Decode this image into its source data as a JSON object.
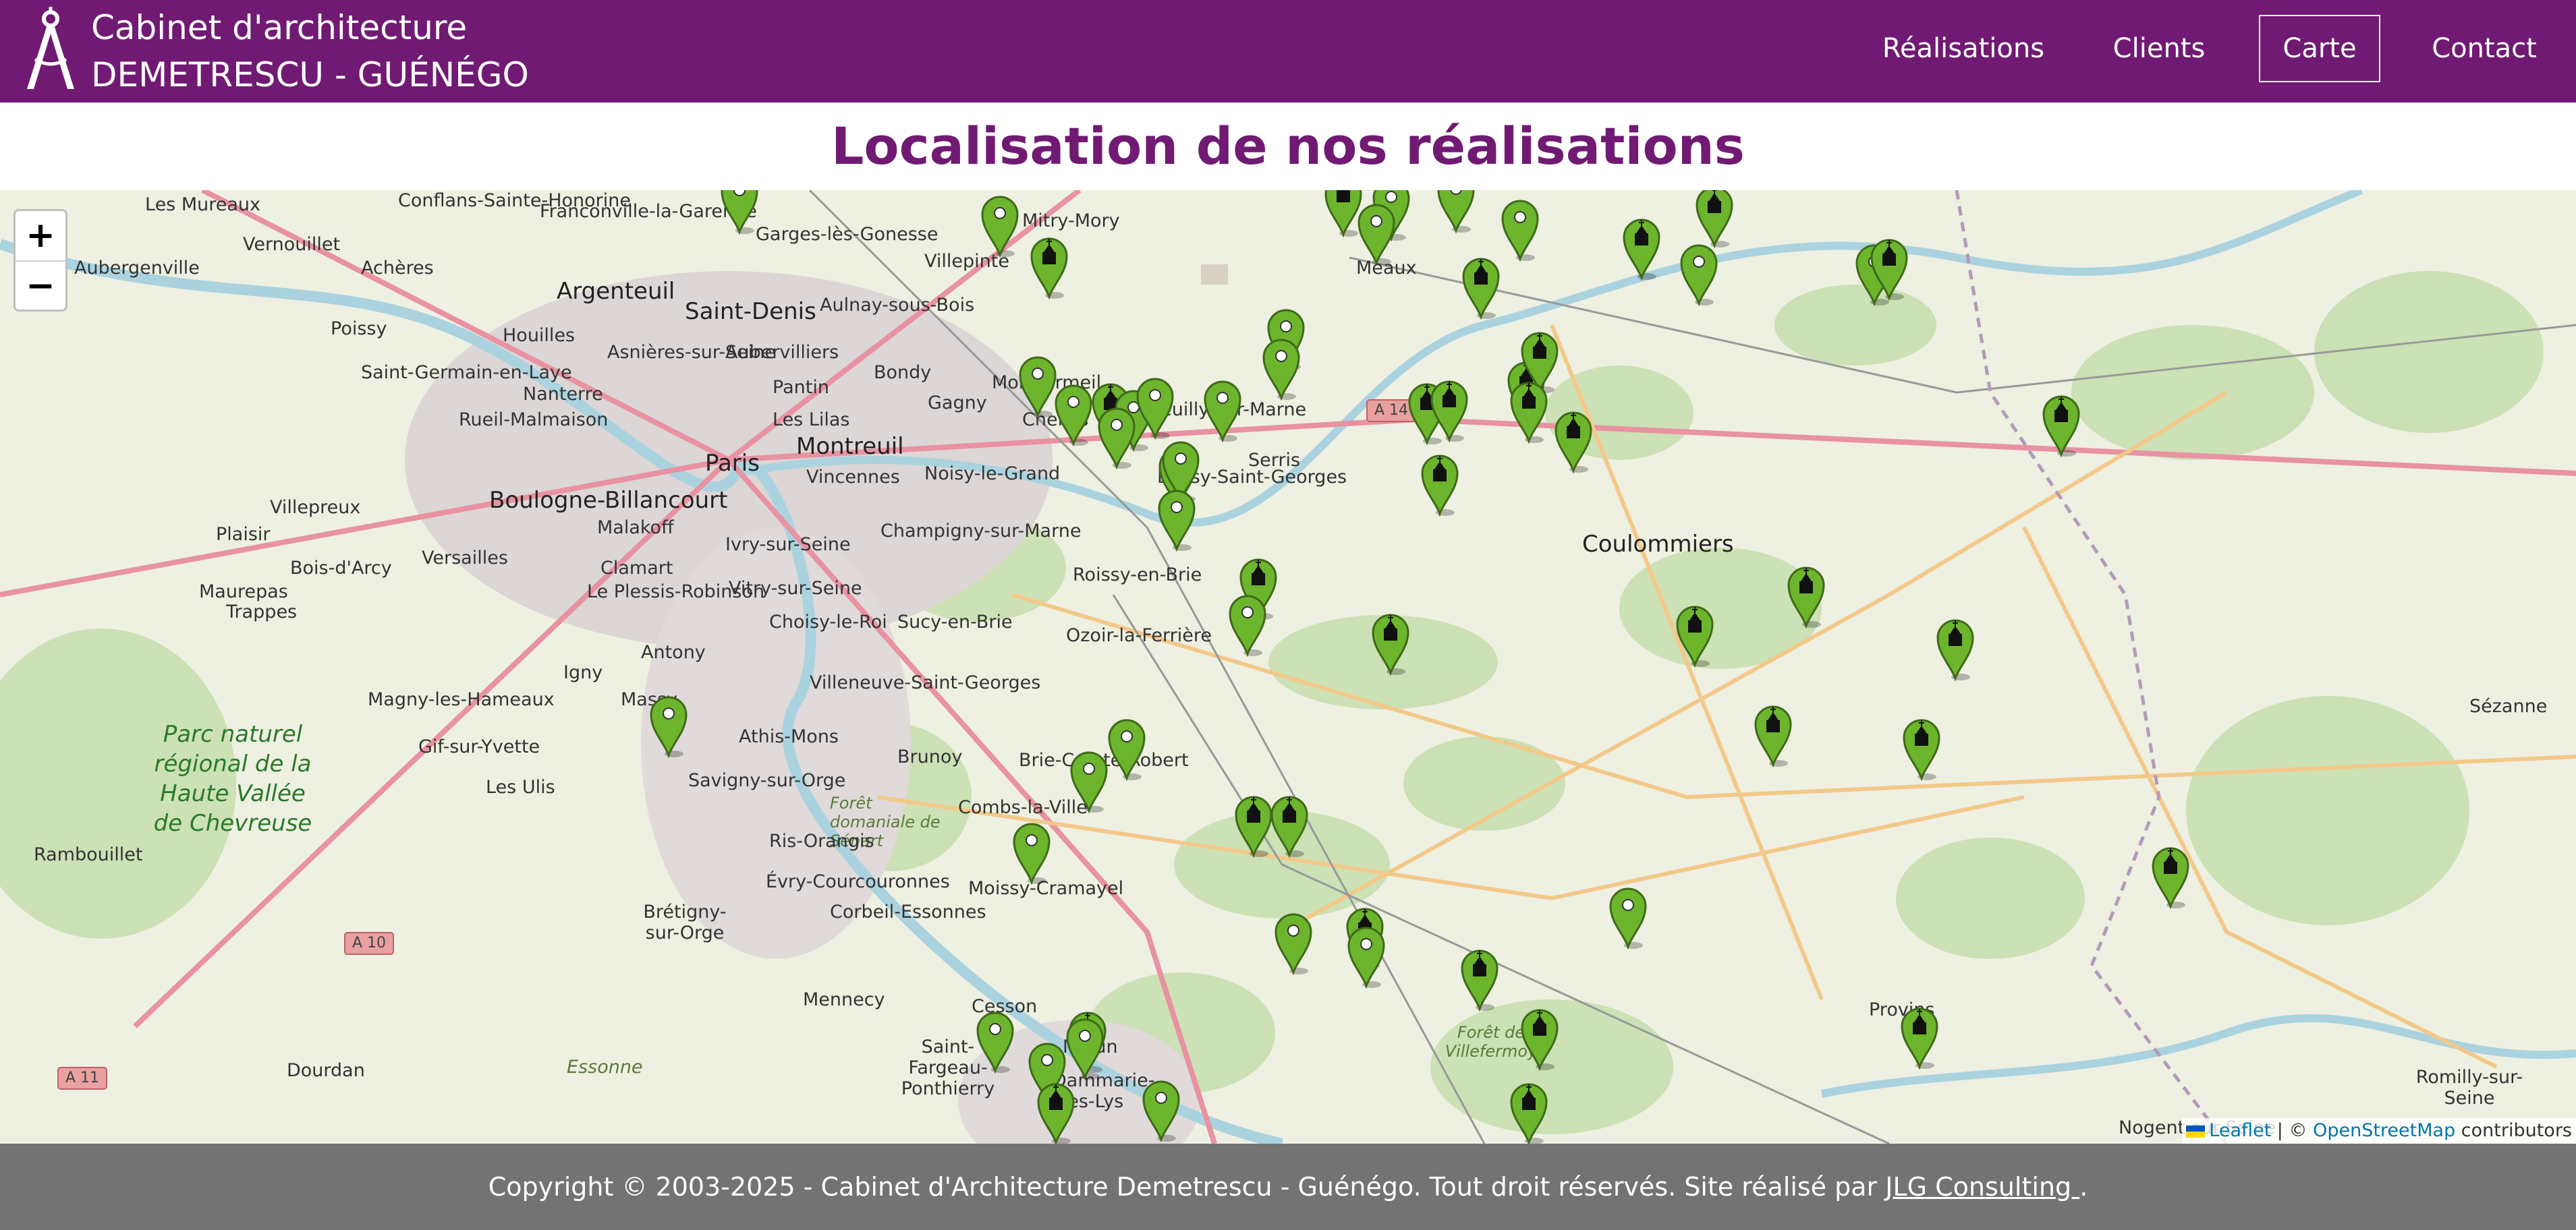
{
  "header": {
    "brand_line1": "Cabinet d'architecture",
    "brand_line2": "DEMETRESCU - GUÉNÉGO",
    "nav": [
      {
        "label": "Réalisations",
        "active": false
      },
      {
        "label": "Clients",
        "active": false
      },
      {
        "label": "Carte",
        "active": true
      },
      {
        "label": "Contact",
        "active": false
      }
    ],
    "background_color": "#701a73"
  },
  "page_title": "Localisation de nos réalisations",
  "map": {
    "zoom_in_label": "+",
    "zoom_out_label": "−",
    "places": [
      "Les Mureaux",
      "Conflans-Sainte-Honorine",
      "Franconville-la-Garenne",
      "Garges-lès-Gonesse",
      "Mitry-Mory",
      "Aubergenville",
      "Vernouillet",
      "Achères",
      "Argenteuil",
      "Saint-Denis",
      "Villepinte",
      "Aulnay-sous-Bois",
      "Poissy",
      "Houilles",
      "Asnières-sur-Seine",
      "Aubervilliers",
      "Saint-Germain-en-Laye",
      "Nanterre",
      "Pantin",
      "Bondy",
      "Gagny",
      "Montfermeil",
      "Chelles",
      "Rueil-Malmaison",
      "Les Lilas",
      "Paris",
      "Montreuil",
      "Vincennes",
      "Noisy-le-Grand",
      "Boulogne-Billancourt",
      "Malakoff",
      "Villepreux",
      "Plaisir",
      "Bois-d'Arcy",
      "Versailles",
      "Clamart",
      "Ivry-sur-Seine",
      "Champigny-sur-Marne",
      "Le Plessis-Robinson",
      "Vitry-sur-Seine",
      "Choisy-le-Roi",
      "Maurepas",
      "Trappes",
      "Antony",
      "Igny",
      "Massy",
      "Sucy-en-Brie",
      "Roissy-en-Brie",
      "Ozoir-la-Ferrière",
      "Villeneuve-Saint-Georges",
      "Athis-Mons",
      "Magny-les-Hameaux",
      "Gif-sur-Yvette",
      "Les Ulis",
      "Savigny-sur-Orge",
      "Brunoy",
      "Brie-Comte-Robert",
      "Forêt domaniale de Sénart",
      "Combs-la-Ville",
      "Ris-Orangis",
      "Évry-Courcouronnes",
      "Corbeil-Essonnes",
      "Moissy-Cramayel",
      "Rambouillet",
      "Brétigny-sur-Orge",
      "Mennecy",
      "Cesson",
      "Saint-Fargeau-Ponthierry",
      "Dammarie-les-Lys",
      "Melun",
      "Dourdan",
      "Essonne",
      "Serris",
      "Coulommiers",
      "Sézanne",
      "Provins",
      "Forêt de Villefermoy",
      "Romilly-sur-Seine",
      "Nogent-sur-Seine",
      "Parc naturel régional de la Haute Vallée de Chevreuse",
      "Meaux",
      "Bussy-Saint-Georges",
      "Neuilly-sur-Marne"
    ],
    "roads": [
      "A 14",
      "A 10",
      "A 11"
    ],
    "attribution": {
      "leaflet": "Leaflet",
      "separator": " | © ",
      "osm": "OpenStreetMap",
      "suffix": " contributors"
    }
  },
  "footer": {
    "text": "Copyright © 2003-2025 - Cabinet d'Architecture Demetrescu - Guénégo. Tout droit réservés. Site réalisé par ",
    "link": "JLG Consulting ",
    "end": "."
  },
  "colors": {
    "brand": "#701a73",
    "marker_green": "#6cb52d",
    "footer": "#737373"
  }
}
